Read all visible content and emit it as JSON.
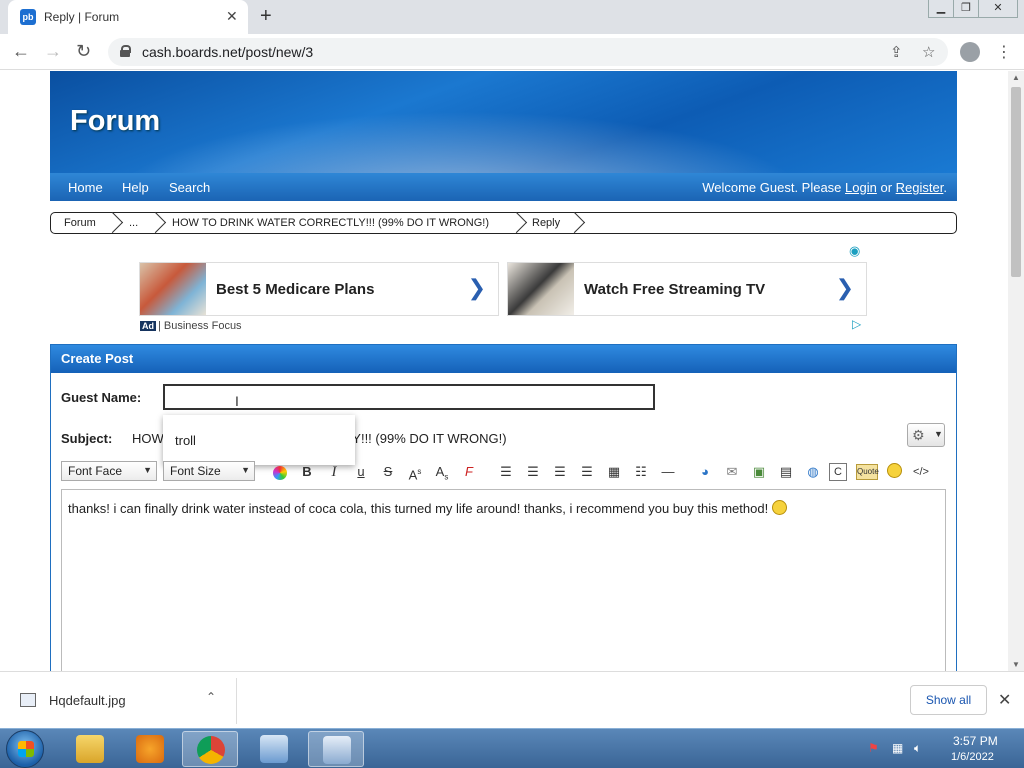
{
  "browser": {
    "tab_title": "Reply | Forum",
    "favicon": "pb",
    "url": "cash.boards.net/post/new/3"
  },
  "site": {
    "title": "Forum",
    "nav": [
      "Home",
      "Help",
      "Search"
    ],
    "welcome_prefix": "Welcome Guest. Please",
    "login": "Login",
    "or": "or",
    "register": "Register",
    "period": "."
  },
  "breadcrumb": [
    "Forum",
    "...",
    "HOW TO DRINK WATER CORRECTLY!!! (99% DO IT WRONG!)",
    "Reply"
  ],
  "ads": {
    "items": [
      {
        "title": "Best 5 Medicare Plans"
      },
      {
        "title": "Watch Free Streaming TV"
      }
    ],
    "badge": "Ad",
    "source": "| Business Focus"
  },
  "form": {
    "panel_title": "Create Post",
    "guest_label": "Guest Name:",
    "guest_value": "",
    "subject_label": "Subject:",
    "subject_value": "HOW TO DRINK WATER CORRECTLY!!! (99% DO IT WRONG!)",
    "autocomplete": [
      "troll"
    ],
    "font_face": "Font Face",
    "font_size": "Font Size",
    "toolbar_icons": [
      "color-icon",
      "bold-icon",
      "italic-icon",
      "underline-icon",
      "strike-icon",
      "superscript-icon",
      "subscript-icon",
      "remove-format-icon",
      "align-left-icon",
      "align-center-icon",
      "align-right-icon",
      "justify-icon",
      "table-icon",
      "list-icon",
      "hr-icon",
      "link-icon",
      "email-icon",
      "image-icon",
      "video-icon",
      "users-icon",
      "code-icon",
      "quote-icon",
      "smiley-icon",
      "source-icon"
    ],
    "message": "thanks! i can finally drink water instead of coca cola, this turned my life around! thanks, i recommend you buy this method!"
  },
  "download": {
    "file": "Hqdefault.jpg",
    "show_all": "Show all"
  },
  "taskbar": {
    "time": "3:57 PM",
    "date": "1/6/2022"
  }
}
